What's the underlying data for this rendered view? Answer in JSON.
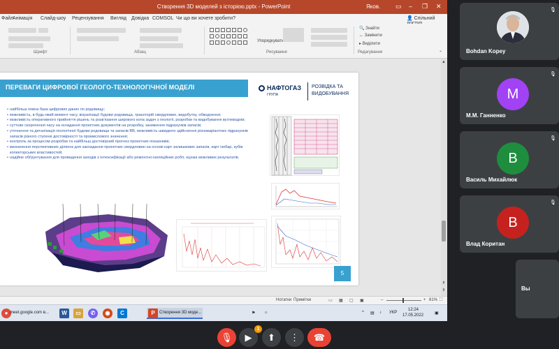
{
  "powerpoint": {
    "window_title": "Створення 3D моделей з історією.pptx - PowerPoint",
    "user": "Яков.",
    "tabs": [
      "Файл",
      "Анімація",
      "Слайд-шоу",
      "Рецензування",
      "Вигляд",
      "Довідка",
      "COMSOL",
      "Чи що ви хочете зробити?"
    ],
    "share_label": "Спільний доступ",
    "ribbon_groups": [
      "Шрифт",
      "Абзац",
      "Рисування",
      "Редагування"
    ],
    "ribbon_labels": {
      "arrange": "Упорядкувати",
      "find": "Знайти",
      "replace": "Замінити",
      "select": "Виділити"
    },
    "statusbar": {
      "notes": "Нотатки",
      "comments": "Примітки",
      "zoom": "61%"
    }
  },
  "slide": {
    "title": "ПЕРЕВАГИ ЦИФРОВОЇ ГЕОЛОГО-ТЕХНОЛОГІЧНОЇ МОДЕЛІ",
    "logo_name": "НАФТОГАЗ",
    "logo_sub": "ГРУПА",
    "logo_line1": "РОЗВІДКА ТА",
    "logo_line2": "ВИДОБУВАННЯ",
    "page_number": "5",
    "bullets": [
      "найбільш повна база цифрових даних по родовищу;",
      "можливість, в будь-який момент часу, візуалізації будови родовища, траєкторій свердловин, видобутку, обводнення;",
      "можливість оперативного прийняття рішень та розв'язання широкого кола задач з геології, розробки та видобування вуглеводнів;",
      "суттєве скорочення часу на складання проектних документів на розробку, заниження підрахунків запасів;",
      "уточнення та деталізація геологічної будови родовища та запасів ВВ, можливість швидкого здійснення різноваріантних підрахунків запасів різного ступеня достовірності та промислового значення;",
      "контроль за процесом розробки та найбільш достовірний прогноз проектних показників;",
      "визначення перспективних ділянок для закладання проектних свердловин на основі карт залишкових запасів, карт ізобар, кубів колекторських властивостей;",
      "надійне обґрунтування для проведення заходів з інтенсифікації або ремонтно-ізоляційних робіт, оцінка можливих результатів."
    ]
  },
  "taskbar": {
    "chrome_tab": "meet.google.com в...",
    "ppt_window": "Створення 3D моде...",
    "lang": "УКР",
    "time": "12:24",
    "date": "17.05.2022"
  },
  "participants": [
    {
      "name": "Bohdan Kopey",
      "initial": "",
      "color": "#ffffff"
    },
    {
      "name": "М.М. Ганненко",
      "initial": "М",
      "color": "#a142f4"
    },
    {
      "name": "Василь Михайлюк",
      "initial": "В",
      "color": "#1e8e3e"
    },
    {
      "name": "Влад Коритан",
      "initial": "В",
      "color": "#c5221f"
    },
    {
      "name": "Вы",
      "initial": "",
      "color": "#3c4043"
    }
  ],
  "controls": {
    "camera_badge": "1",
    "mic_color": "#ea4335",
    "hangup_color": "#ea4335"
  }
}
